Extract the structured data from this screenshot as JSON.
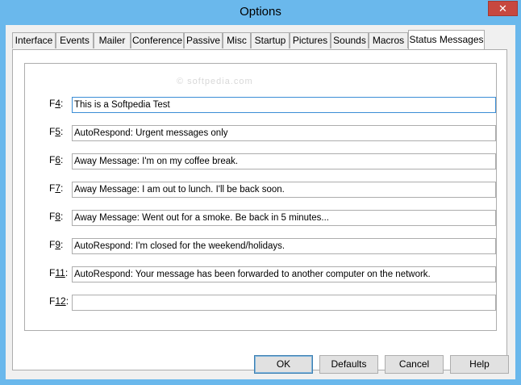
{
  "window": {
    "title": "Options",
    "close_glyph": "✕"
  },
  "tabs": [
    {
      "label": "Interface"
    },
    {
      "label": "Events"
    },
    {
      "label": "Mailer"
    },
    {
      "label": "Conference"
    },
    {
      "label": "Passive"
    },
    {
      "label": "Misc"
    },
    {
      "label": "Startup"
    },
    {
      "label": "Pictures"
    },
    {
      "label": "Sounds"
    },
    {
      "label": "Macros"
    },
    {
      "label": "Status Messages",
      "active": true
    }
  ],
  "watermark": "© softpedia.com",
  "messages": [
    {
      "key": "F",
      "num": "4",
      "value": "This is a Softpedia Test"
    },
    {
      "key": "F",
      "num": "5",
      "value": "AutoRespond: Urgent messages only"
    },
    {
      "key": "F",
      "num": "6",
      "value": "Away Message: I'm on my coffee break."
    },
    {
      "key": "F",
      "num": "7",
      "value": "Away Message: I am out to lunch. I'll be back soon."
    },
    {
      "key": "F",
      "num": "8",
      "value": "Away Message: Went out for a smoke. Be back in 5 minutes..."
    },
    {
      "key": "F",
      "num": "9",
      "value": "AutoRespond: I'm closed for the weekend/holidays."
    },
    {
      "key": "F",
      "num": "11",
      "value": "AutoRespond: Your message has been forwarded to another computer on the network."
    },
    {
      "key": "F",
      "num": "12",
      "value": ""
    }
  ],
  "buttons": {
    "ok": "OK",
    "defaults": "Defaults",
    "cancel": "Cancel",
    "help": "Help"
  },
  "colors": {
    "titlebar": "#6ab8ec",
    "close": "#c7483f",
    "focus_border": "#3b8ed6"
  }
}
